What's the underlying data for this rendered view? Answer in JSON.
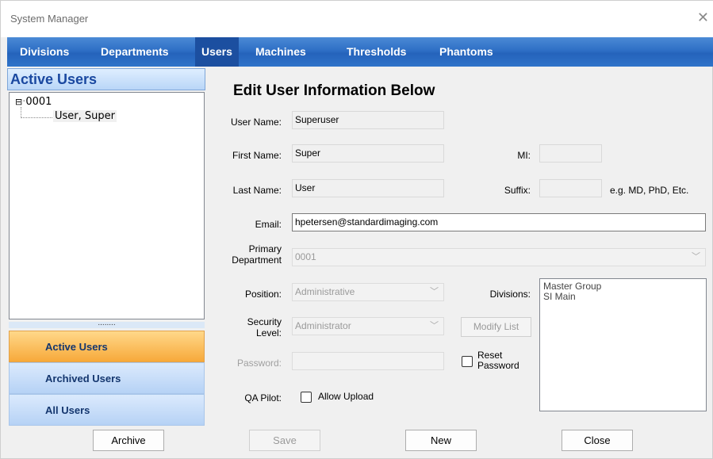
{
  "window": {
    "title": "System Manager"
  },
  "tabs": [
    {
      "label": "Divisions"
    },
    {
      "label": "Departments"
    },
    {
      "label": "Users"
    },
    {
      "label": "Machines"
    },
    {
      "label": "Thresholds"
    },
    {
      "label": "Phantoms"
    }
  ],
  "left_panel": {
    "header": "Active Users",
    "tree": {
      "root": "0001",
      "child": "User, Super"
    },
    "splitter": "........",
    "nav": [
      {
        "label": "Active Users"
      },
      {
        "label": "Archived Users"
      },
      {
        "label": "All Users"
      }
    ],
    "archive_button": "Archive"
  },
  "form": {
    "title": "Edit User Information Below",
    "user_name": {
      "label": "User Name:",
      "value": "Superuser"
    },
    "first_name": {
      "label": "First Name:",
      "value": "Super"
    },
    "mi": {
      "label": "MI:",
      "value": ""
    },
    "last_name": {
      "label": "Last Name:",
      "value": "User"
    },
    "suffix": {
      "label": "Suffix:",
      "value": "",
      "hint": "e.g. MD, PhD, Etc."
    },
    "email": {
      "label": "Email:",
      "value": "hpetersen@standardimaging.com"
    },
    "primary_department": {
      "label_line1": "Primary",
      "label_line2": "Department",
      "value": "0001"
    },
    "position": {
      "label": "Position:",
      "value": "Administrative"
    },
    "divisions": {
      "label": "Divisions:",
      "items": [
        "Master Group",
        "SI Main"
      ]
    },
    "security_level": {
      "label_line1": "Security",
      "label_line2": "Level:",
      "value": "Administrator"
    },
    "modify_list": "Modify List",
    "password": {
      "label": "Password:",
      "value": ""
    },
    "reset_password": {
      "line1": "Reset",
      "line2": "Password"
    },
    "qa_pilot": {
      "label": "QA Pilot:",
      "allow_upload": "Allow Upload"
    }
  },
  "buttons": {
    "save": "Save",
    "new": "New",
    "close": "Close"
  }
}
